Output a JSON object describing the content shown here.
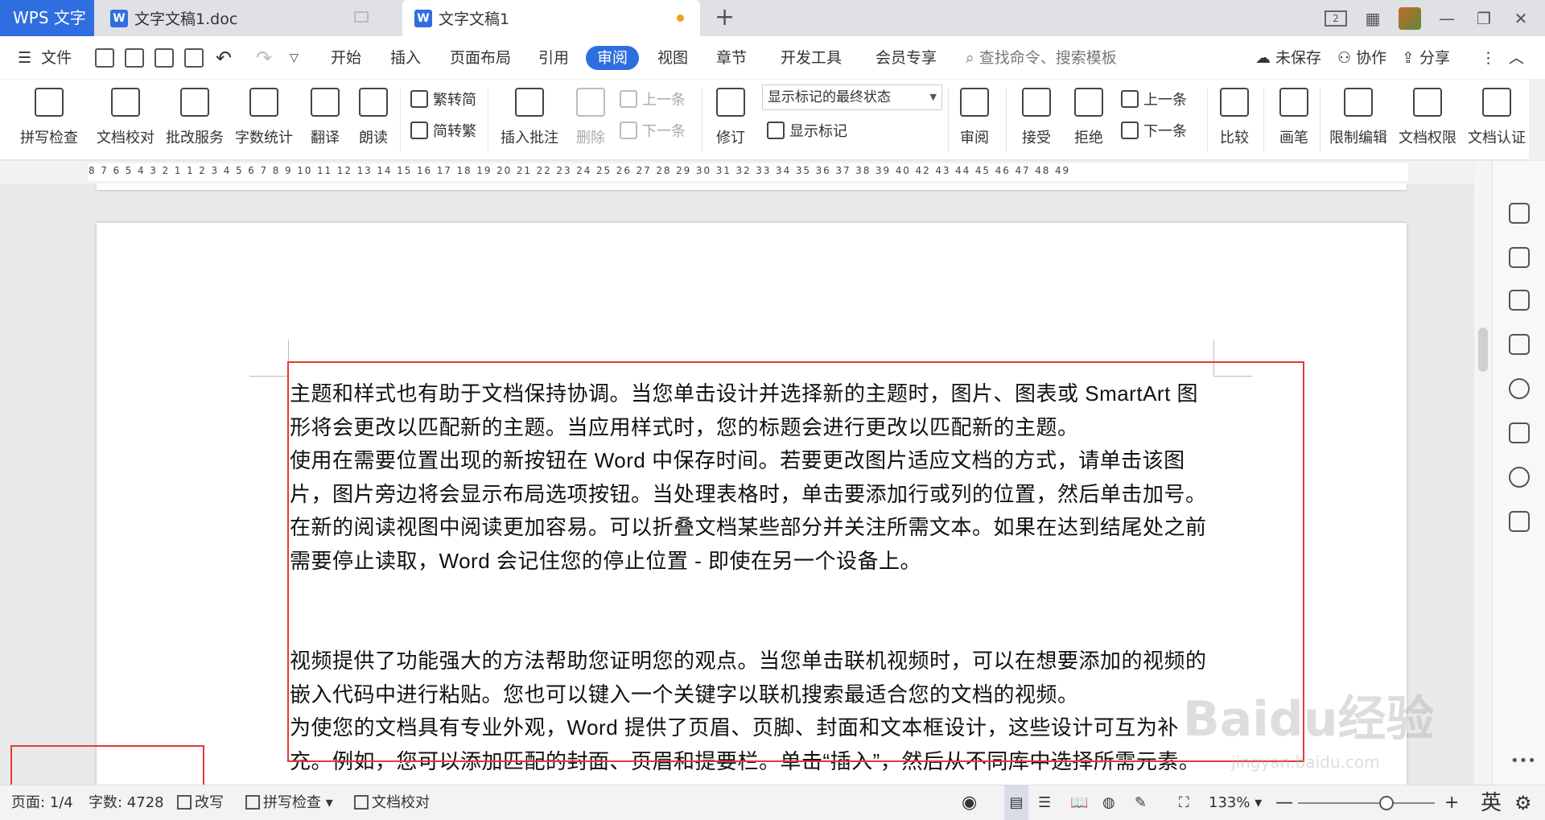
{
  "titlebar": {
    "brand": "WPS 文字",
    "tabs": [
      {
        "label": "文字文稿1.doc"
      },
      {
        "label": "文字文稿1"
      }
    ],
    "add_tab": "+",
    "page_indicator": "2"
  },
  "menubar": {
    "file": "文件",
    "tabs": [
      "开始",
      "插入",
      "页面布局",
      "引用",
      "审阅",
      "视图",
      "章节",
      "开发工具",
      "会员专享"
    ],
    "active_tab": "审阅",
    "search_placeholder": "查找命令、搜索模板",
    "right": [
      "未保存",
      "协作",
      "分享"
    ]
  },
  "ribbon": {
    "spell_check": "拼写检查",
    "doc_proof": "文档校对",
    "review_service": "批改服务",
    "word_count": "字数统计",
    "translate": "翻译",
    "read_aloud": "朗读",
    "trad_to_simp": "繁转简",
    "simp_to_trad": "简转繁",
    "insert_comment": "插入批注",
    "delete": "删除",
    "prev": "上一条",
    "next": "下一条",
    "revise": "修订",
    "markup_state": "显示标记的最终状态",
    "show_markup": "显示标记",
    "review": "审阅",
    "accept": "接受",
    "reject": "拒绝",
    "prev2": "上一条",
    "next2": "下一条",
    "compare": "比较",
    "pen": "画笔",
    "restrict_edit": "限制编辑",
    "doc_permission": "文档权限",
    "doc_auth": "文档认证"
  },
  "ruler": {
    "numbers": "8   7   6   5   4   3   2   1         1   2   3   4   5   6   7   8   9  10  11  12  13  14  15  16  17  18  19  20  21  22  23  24  25  26  27  28  29  30  31  32  33  34  35  36  37  38  39  40        42  43  44  45  46  47  48  49"
  },
  "document": {
    "paragraphs": [
      "主题和样式也有助于文档保持协调。当您单击设计并选择新的主题时，图片、图表或 SmartArt 图形将会更改以匹配新的主题。当应用样式时，您的标题会进行更改以匹配新的主题。",
      "使用在需要位置出现的新按钮在 Word 中保存时间。若要更改图片适应文档的方式，请单击该图片，图片旁边将会显示布局选项按钮。当处理表格时，单击要添加行或列的位置，然后单击加号。",
      "在新的阅读视图中阅读更加容易。可以折叠文档某些部分并关注所需文本。如果在达到结尾处之前需要停止读取，Word 会记住您的停止位置 - 即使在另一个设备上。",
      "视频提供了功能强大的方法帮助您证明您的观点。当您单击联机视频时，可以在想要添加的视频的嵌入代码中进行粘贴。您也可以键入一个关键字以联机搜索最适合您的文档的视频。",
      "为使您的文档具有专业外观，Word 提供了页眉、页脚、封面和文本框设计，这些设计可互为补充。例如，您可以添加匹配的封面、页眉和提要栏。单击“插入”，然后从不同库中选择所需元素。"
    ]
  },
  "statusbar": {
    "page": "页面: 1/4",
    "word_count": "字数: 4728",
    "overwrite": "改写",
    "spell_check": "拼写检查",
    "doc_proof": "文档校对",
    "zoom": "133%",
    "ime": "英"
  },
  "watermark": {
    "brand": "Baidu经验",
    "url": "jingyan.baidu.com"
  },
  "colors": {
    "accent": "#2f6ee0",
    "highlight_box": "#e53935",
    "unsaved_dot": "#f0a020"
  }
}
